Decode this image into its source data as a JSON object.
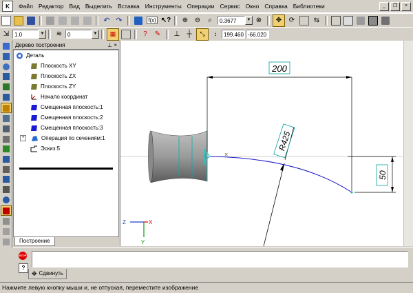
{
  "menu": {
    "items": [
      "Файл",
      "Редактор",
      "Вид",
      "Выделить",
      "Вставка",
      "Инструменты",
      "Операции",
      "Сервис",
      "Окно",
      "Справка",
      "Библиотеки"
    ]
  },
  "toolbar1": {
    "zoom_value": "0.3677",
    "fx_label": "f(x)"
  },
  "toolbar2": {
    "line_scale": "1.0",
    "layer": "0",
    "coord_x": "199.460",
    "coord_y": "-66.020"
  },
  "tree": {
    "title": "Дерево построения",
    "root": "Деталь",
    "items": [
      "Плоскость XY",
      "Плоскость ZX",
      "Плоскость ZY",
      "Начало координат",
      "Смещенная плоскость:1",
      "Смещенная плоскость:2",
      "Смещенная плоскость:3",
      "Операция по сечениям:1",
      "Эскиз:5"
    ],
    "tab_label": "Построение"
  },
  "drawing": {
    "dim_horizontal": "200",
    "dim_radius": "R425",
    "dim_vertical": "50",
    "axis_z": "Z",
    "axis_x": "X",
    "axis_y": "Y"
  },
  "property_bar": {
    "tab_label": "Сдвинуть",
    "stop_label": "STOP"
  },
  "status": {
    "text": "Нажмите левую кнопку мыши и, не отпуская, переместите изображение"
  },
  "colors": {
    "sketch_line": "#1818c8",
    "dimension": "#000000",
    "dimension_text_box": "#00a0a0",
    "accent": "#00a0a0"
  }
}
